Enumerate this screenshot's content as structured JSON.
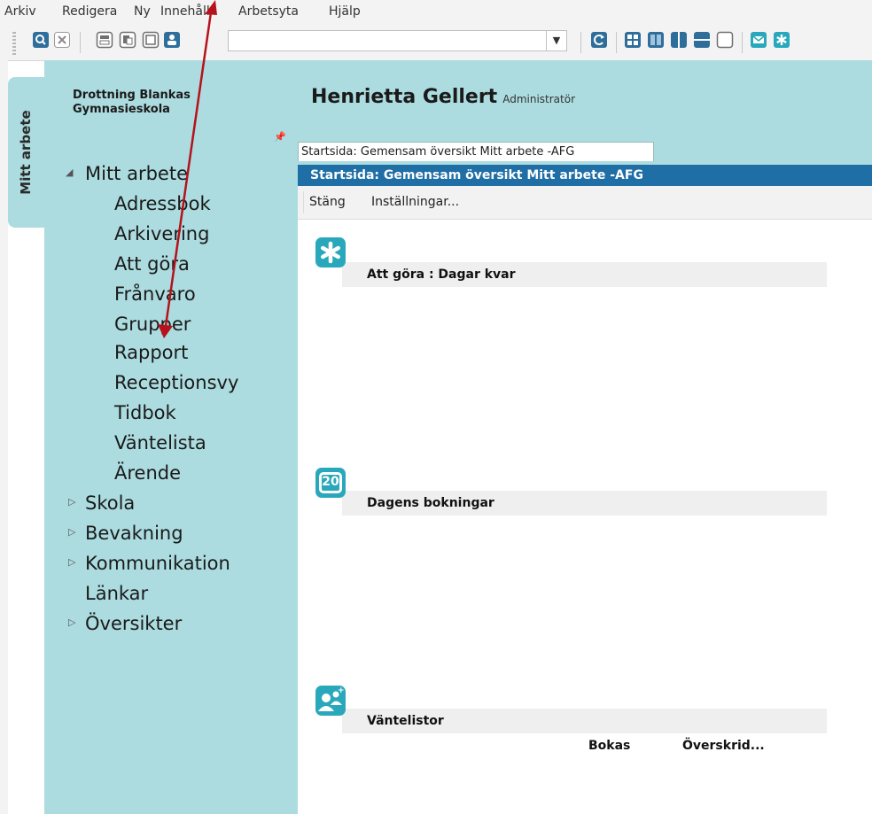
{
  "menu": [
    "Arkiv",
    "Redigera",
    "Ny",
    "Innehåll",
    "Arbetsyta",
    "Hjälp"
  ],
  "vertical_tab": "Mitt arbete",
  "school_name": [
    "Drottning Blankas",
    "Gymnasieskola"
  ],
  "nav": {
    "mitt_arbete": "Mitt arbete",
    "subitems": [
      "Adressbok",
      "Arkivering",
      "Att göra",
      "Frånvaro",
      "Grupper",
      "Rapport",
      "Receptionsvy",
      "Tidbok",
      "Väntelista",
      "Ärende"
    ],
    "sections": [
      "Skola",
      "Bevakning",
      "Kommunikation",
      "Länkar",
      "Översikter"
    ]
  },
  "header": {
    "user_name": "Henrietta Gellert",
    "role": "Administratör"
  },
  "tab_label": "Startsida: Gemensam översikt Mitt arbete -AFG",
  "panel_title": "Startsida: Gemensam översikt Mitt arbete -AFG",
  "actions": {
    "close": "Stäng",
    "settings": "Inställningar..."
  },
  "widgets": {
    "todo": {
      "title": "Att göra : Dagar kvar"
    },
    "bookings": {
      "title": "Dagens bokningar",
      "icon_text": "20"
    },
    "waitlists": {
      "title": "Väntelistor",
      "columns": [
        "Bokas",
        "Överskrid..."
      ]
    }
  },
  "colors": {
    "sidebar": "#acdce0",
    "titlebar": "#1f6ea5",
    "accent_icon": "#2aa8bb",
    "arrow": "#b5121b"
  }
}
